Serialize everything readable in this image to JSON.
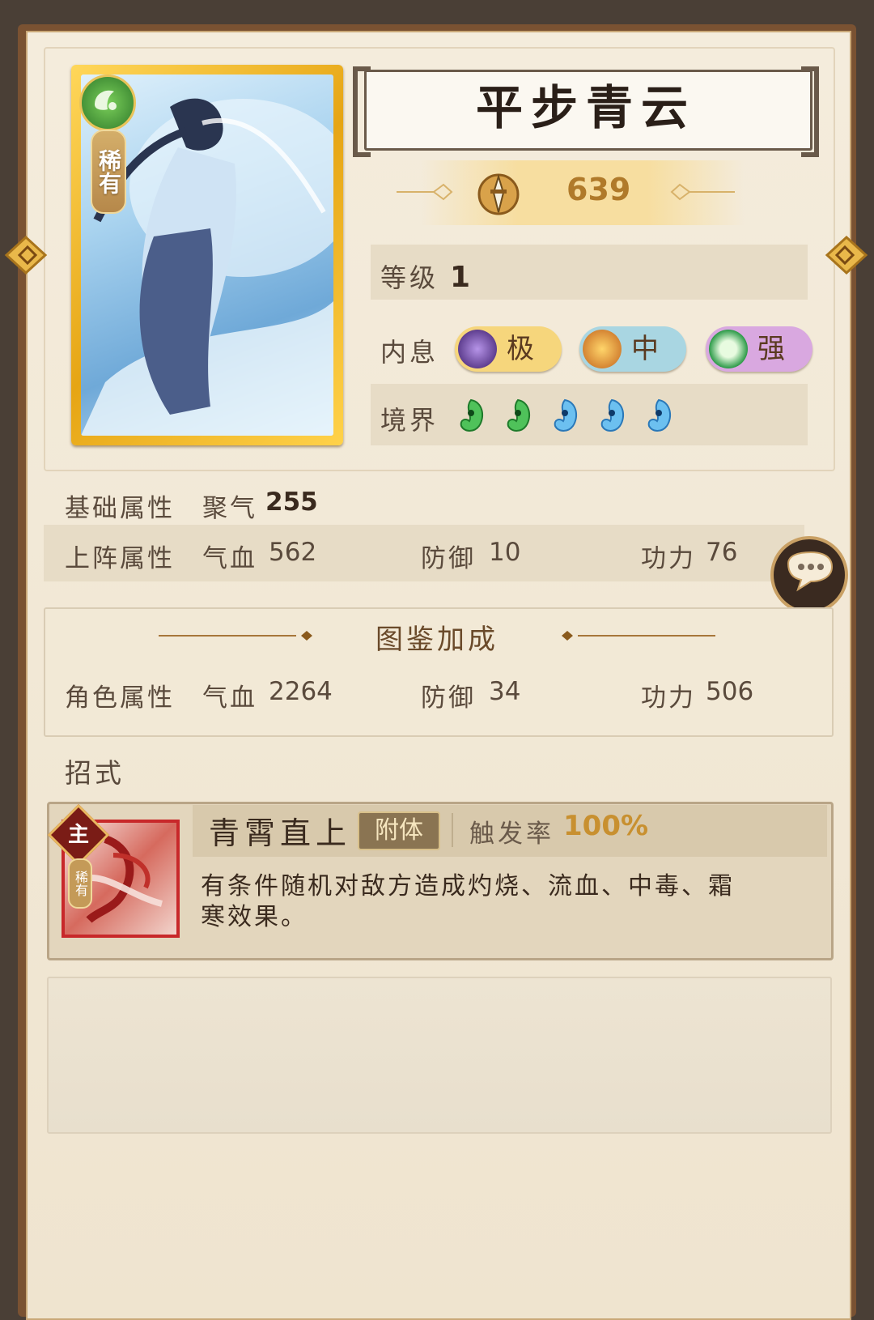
{
  "hero": {
    "name": "平步青云",
    "rarity": "稀有",
    "power": "639",
    "element_icon": "leaf-swirl-icon"
  },
  "info": {
    "level_label": "等级",
    "level_value": "1",
    "neixi_label": "内息",
    "neixi": [
      {
        "grade": "极",
        "orb": "moon-orb-icon",
        "color": "#f6d67c"
      },
      {
        "grade": "中",
        "orb": "sun-orb-icon",
        "color": "#a9d6e2"
      },
      {
        "grade": "强",
        "orb": "jade-orb-icon",
        "color": "#d9a8e0"
      }
    ],
    "realm_label": "境界",
    "realm": [
      "green",
      "green",
      "blue",
      "blue",
      "blue"
    ]
  },
  "base_attr": {
    "label": "基础属性",
    "juqi_label": "聚气",
    "juqi_value": "255"
  },
  "deploy_attr": {
    "label": "上阵属性",
    "hp_label": "气血",
    "hp_value": "562",
    "def_label": "防御",
    "def_value": "10",
    "atk_label": "功力",
    "atk_value": "76"
  },
  "codex": {
    "title": "图鉴加成",
    "label": "角色属性",
    "hp_label": "气血",
    "hp_value": "2264",
    "def_label": "防御",
    "def_value": "34",
    "atk_label": "功力",
    "atk_value": "506"
  },
  "skills": {
    "label": "招式",
    "items": [
      {
        "badge": "主",
        "rarity": "稀有",
        "name": "青霄直上",
        "tag": "附体",
        "trigger_label": "触发率",
        "trigger_value": "100%",
        "desc": "有条件随机对敌方造成灼烧、流血、中毒、霜寒效果。"
      }
    ]
  }
}
